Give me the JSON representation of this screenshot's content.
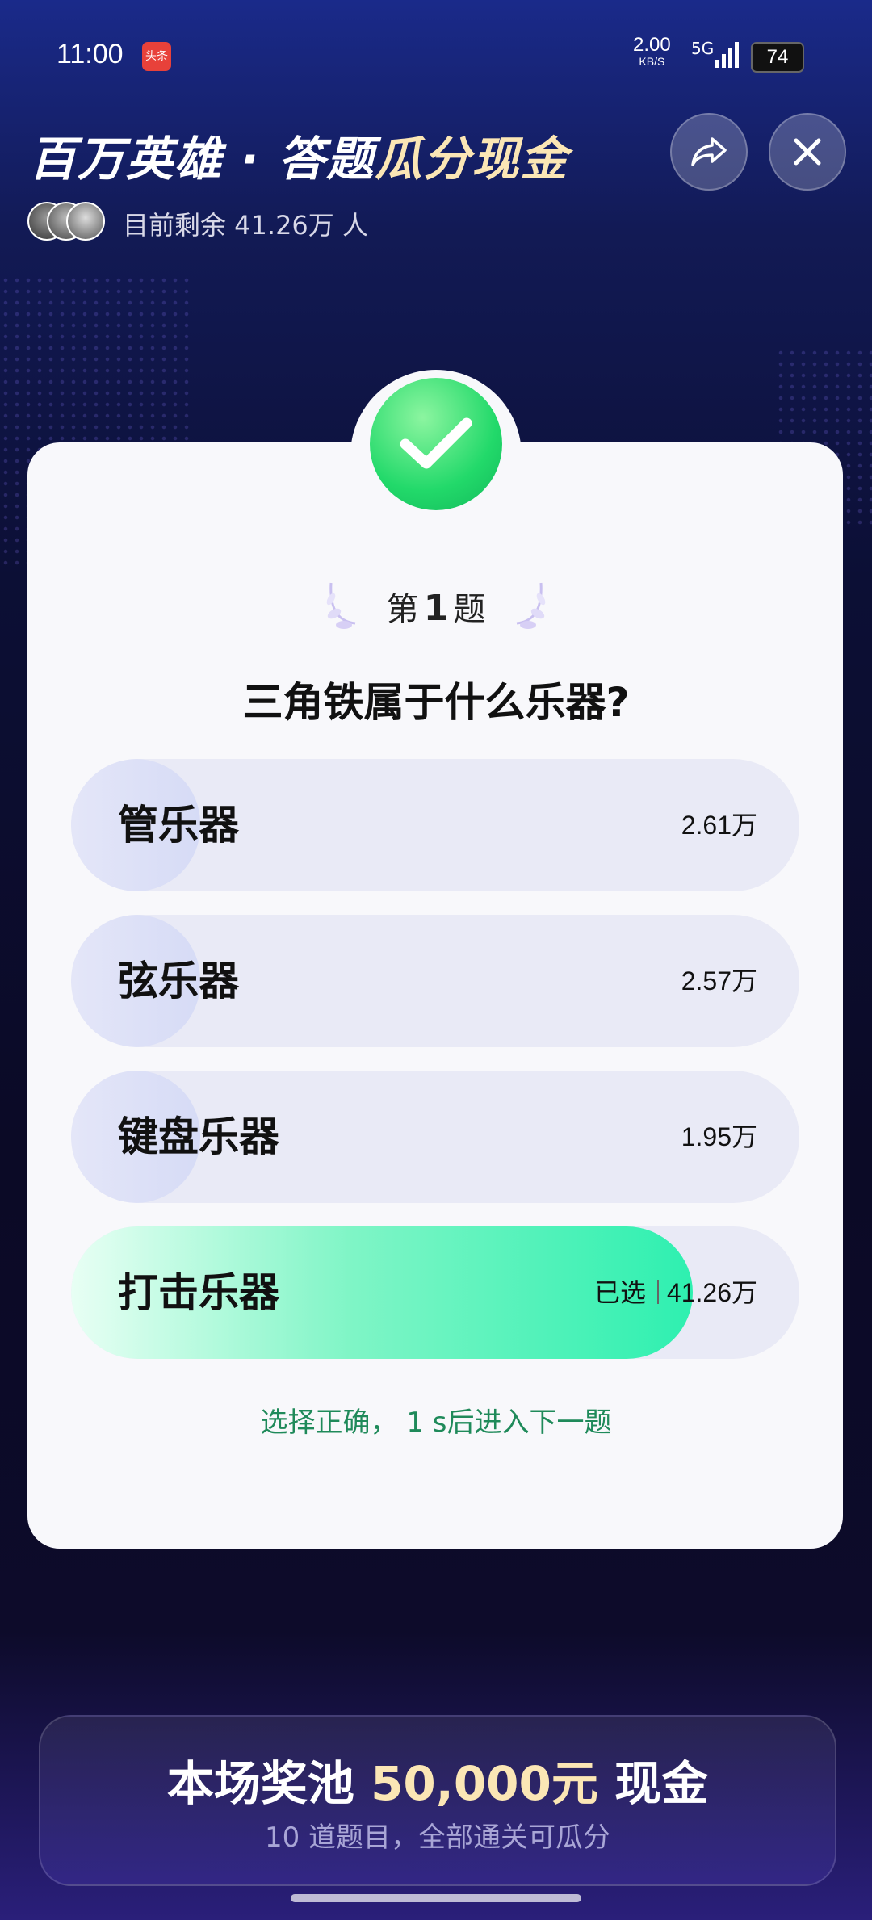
{
  "status_bar": {
    "time": "11:00",
    "app_badge": "头条",
    "net_speed": "2.00",
    "net_unit": "KB/S",
    "network_type": "5G",
    "battery": "74"
  },
  "header": {
    "title_part1": "百万英雄 · 答题",
    "title_part2": "瓜分现金",
    "remaining_label": "目前剩余 41.26万 人"
  },
  "quiz": {
    "question_prefix": "第",
    "question_number": "1",
    "question_suffix": "题",
    "question": "三角铁属于什么乐器?",
    "options": [
      {
        "label": "管乐器",
        "count": "2.61万",
        "share": 0.0633
      },
      {
        "label": "弦乐器",
        "count": "2.57万",
        "share": 0.0623
      },
      {
        "label": "键盘乐器",
        "count": "1.95万",
        "share": 0.0473
      },
      {
        "label": "打击乐器",
        "count": "41.26万",
        "share": 0.8271,
        "selected_label": "已选"
      }
    ],
    "feedback": "选择正确， 1 s后进入下一题"
  },
  "prize": {
    "prefix": "本场奖池",
    "amount": "50,000元",
    "suffix": "现金",
    "subtitle": "10 道题目，全部通关可瓜分"
  },
  "colors": {
    "accent_gold": "#fbe6b5",
    "correct_green": "#22d96a",
    "feedback_green": "#1f8a5a"
  }
}
